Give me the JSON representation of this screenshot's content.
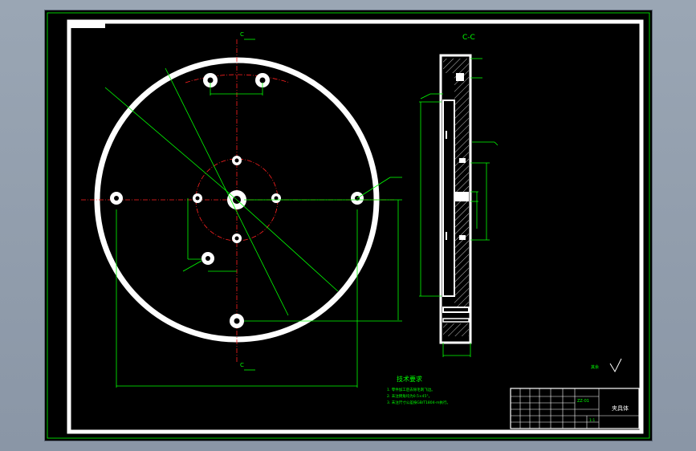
{
  "drawing": {
    "section_label": "C-C",
    "cut_label_top": "C",
    "cut_label_bottom": "C",
    "notes_title": "技术要求",
    "notes": [
      "1. 零件加工后去除毛刺飞边。",
      "2. 未注倒角均为0.5×45°。",
      "3. 未注尺寸公差按GB/T1804-m执行。"
    ],
    "roughness_mark": "其余",
    "title_block": {
      "part_name": "夹具体",
      "drawing_no": "ZZ-01",
      "scale": "1:1"
    }
  },
  "colors": {
    "background": "#000000",
    "frame": "#ffffff",
    "dimension": "#00ff00",
    "centerline": "#ff2020"
  }
}
